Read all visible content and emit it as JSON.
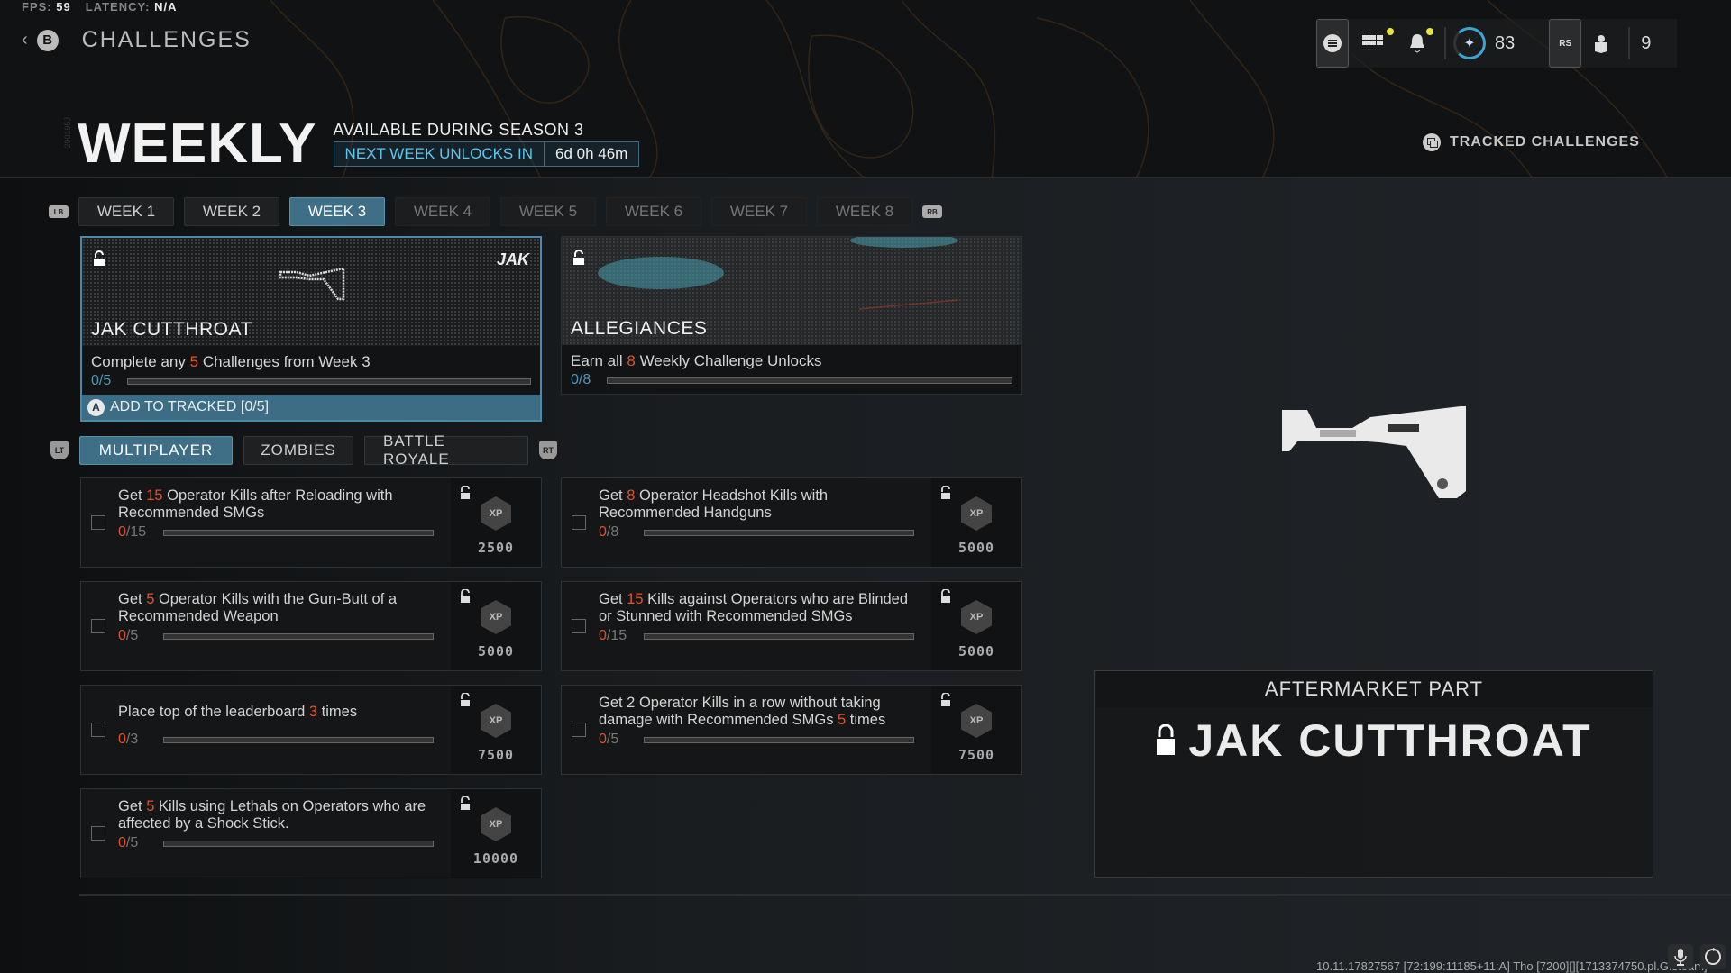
{
  "perf": {
    "fps_label": "FPS:",
    "fps": "59",
    "latency_label": "LATENCY:",
    "latency": "N/A"
  },
  "nav": {
    "back_button": "B",
    "title": "CHALLENGES"
  },
  "topbar": {
    "menu_icon": "menu-icon",
    "grid_icon": "grid-icon",
    "bell_icon": "bell-icon",
    "level": "83",
    "rs_label": "RS",
    "party_count": "9"
  },
  "header": {
    "title": "WEEKLY",
    "side_code": "290195J",
    "season": "AVAILABLE DURING SEASON 3",
    "unlock_label": "NEXT WEEK UNLOCKS IN",
    "unlock_time": "6d 0h 46m",
    "tracked_label": "TRACKED CHALLENGES"
  },
  "week_tabs": {
    "lb": "LB",
    "rb": "RB",
    "items": [
      {
        "label": "WEEK 1",
        "state": "unlocked"
      },
      {
        "label": "WEEK 2",
        "state": "unlocked"
      },
      {
        "label": "WEEK 3",
        "state": "active"
      },
      {
        "label": "WEEK 4",
        "state": "locked"
      },
      {
        "label": "WEEK 5",
        "state": "locked"
      },
      {
        "label": "WEEK 6",
        "state": "locked"
      },
      {
        "label": "WEEK 7",
        "state": "locked"
      },
      {
        "label": "WEEK 8",
        "state": "locked"
      }
    ]
  },
  "rewards": [
    {
      "name": "JAK CUTTHROAT",
      "desc_pre": "Complete any ",
      "desc_num": "5",
      "desc_post": " Challenges from Week 3",
      "progress": "0/5",
      "progress_fraction": 0,
      "track_button": "A",
      "track_label": "ADD TO TRACKED [0/5]",
      "brand": "JAK"
    },
    {
      "name": "ALLEGIANCES",
      "desc_pre": "Earn all ",
      "desc_num": "8",
      "desc_post": " Weekly Challenge Unlocks",
      "progress": "0/8",
      "progress_fraction": 0
    }
  ],
  "mode_tabs": {
    "lt": "LT",
    "rt": "RT",
    "items": [
      {
        "label": "MULTIPLAYER",
        "active": true
      },
      {
        "label": "ZOMBIES",
        "active": false
      },
      {
        "label": "BATTLE ROYALE",
        "active": false
      }
    ]
  },
  "challenges": [
    {
      "pre": "Get ",
      "num": "15",
      "post": " Operator Kills after Reloading with Recommended SMGs",
      "current": "0",
      "total": "/15",
      "progress_fraction": 0,
      "xp": "2500"
    },
    {
      "pre": "Get ",
      "num": "8",
      "post": " Operator Headshot Kills with Recommended Handguns",
      "current": "0",
      "total": "/8",
      "progress_fraction": 0,
      "xp": "5000"
    },
    {
      "pre": "Get ",
      "num": "5",
      "post": " Operator Kills with the Gun-Butt of a Recommended Weapon",
      "current": "0",
      "total": "/5",
      "progress_fraction": 0,
      "xp": "5000"
    },
    {
      "pre": "Get ",
      "num": "15",
      "post": " Kills against Operators who are Blinded or Stunned with Recommended SMGs",
      "current": "0",
      "total": "/15",
      "progress_fraction": 0,
      "xp": "5000"
    },
    {
      "pre": "Place top of the leaderboard ",
      "num": "3",
      "post": " times",
      "current": "0",
      "total": "/3",
      "progress_fraction": 0,
      "xp": "7500"
    },
    {
      "pre": "Get 2 Operator Kills in a row without taking damage with Recommended SMGs ",
      "num": "5",
      "post": " times",
      "current": "0",
      "total": "/5",
      "progress_fraction": 0,
      "xp": "7500"
    },
    {
      "pre": "Get ",
      "num": "5",
      "post": " Kills using Lethals on Operators who are affected by a Shock Stick.",
      "current": "0",
      "total": "/5",
      "progress_fraction": 0,
      "xp": "10000"
    }
  ],
  "xp_badge": "XP",
  "preview": {
    "category": "AFTERMARKET PART",
    "name": "JAK CUTTHROAT"
  },
  "footer": {
    "build": "10.11.17827567 [72:199:11185+11:A] Tho [7200][][1713374750.pl.G.steam]"
  },
  "colors": {
    "accent": "#3f6f87",
    "highlight": "#e0532a",
    "timer": "#5cc8f0",
    "notify": "#e5e53a"
  }
}
